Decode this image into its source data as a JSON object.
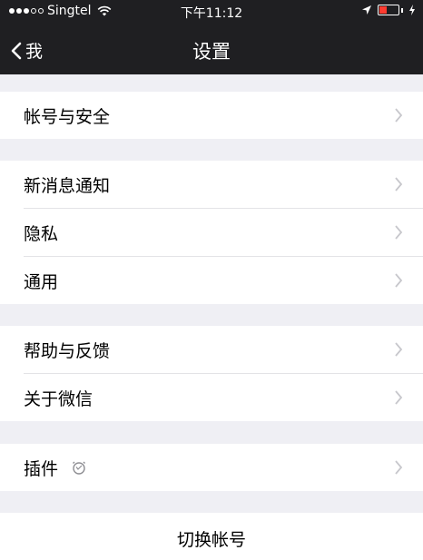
{
  "status_bar": {
    "carrier": "Singtel",
    "time": "下午11:12",
    "battery_percent": 40
  },
  "nav": {
    "back_label": "我",
    "title": "设置"
  },
  "groups": [
    {
      "items": [
        {
          "label": "帐号与安全"
        }
      ]
    },
    {
      "items": [
        {
          "label": "新消息通知"
        },
        {
          "label": "隐私"
        },
        {
          "label": "通用"
        }
      ]
    },
    {
      "items": [
        {
          "label": "帮助与反馈"
        },
        {
          "label": "关于微信"
        }
      ]
    },
    {
      "items": [
        {
          "label": "插件",
          "icon": "plugin-icon"
        }
      ]
    }
  ],
  "switch_account": {
    "label": "切换帐号"
  },
  "colors": {
    "topbar": "#1f1f22",
    "background": "#efeff4",
    "chevron": "#c7c7cc"
  }
}
